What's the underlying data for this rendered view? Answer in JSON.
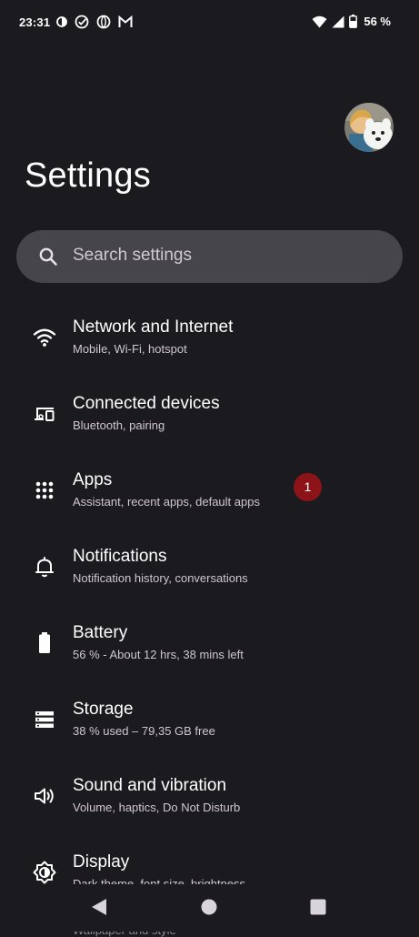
{
  "status_bar": {
    "time": "23:31",
    "battery": "56 %",
    "icons": [
      "data-saver-icon",
      "check-circle-icon",
      "globe-icon",
      "gmail-icon",
      "wifi-icon",
      "signal-icon",
      "battery-icon"
    ]
  },
  "header": {
    "title": "Settings",
    "avatar": "profile-photo"
  },
  "search": {
    "placeholder": "Search settings",
    "icon": "search-icon"
  },
  "settings": [
    {
      "title": "Network and Internet",
      "subtitle": "Mobile, Wi-Fi, hotspot",
      "icon": "wifi-icon"
    },
    {
      "title": "Connected devices",
      "subtitle": "Bluetooth, pairing",
      "icon": "devices-icon"
    },
    {
      "title": "Apps",
      "subtitle": "Assistant, recent apps, default apps",
      "icon": "apps-grid-icon",
      "badge": "1"
    },
    {
      "title": "Notifications",
      "subtitle": "Notification history, conversations",
      "icon": "bell-icon"
    },
    {
      "title": "Battery",
      "subtitle": "56 % - About 12 hrs, 38 mins left",
      "icon": "battery-icon"
    },
    {
      "title": "Storage",
      "subtitle": "38 % used – 79,35 GB free",
      "icon": "storage-icon"
    },
    {
      "title": "Sound and vibration",
      "subtitle": "Volume, haptics, Do Not Disturb",
      "icon": "speaker-icon"
    },
    {
      "title": "Display",
      "subtitle": "Dark theme, font size, brightness",
      "icon": "brightness-icon"
    }
  ],
  "peek": {
    "text": "Wallpaper and style"
  },
  "nav_bar": {
    "icons": [
      "back-icon",
      "home-icon",
      "recents-icon"
    ]
  },
  "colors": {
    "background": "#1b1a1e",
    "search_bar": "#46454a",
    "badge": "#8c1418"
  }
}
